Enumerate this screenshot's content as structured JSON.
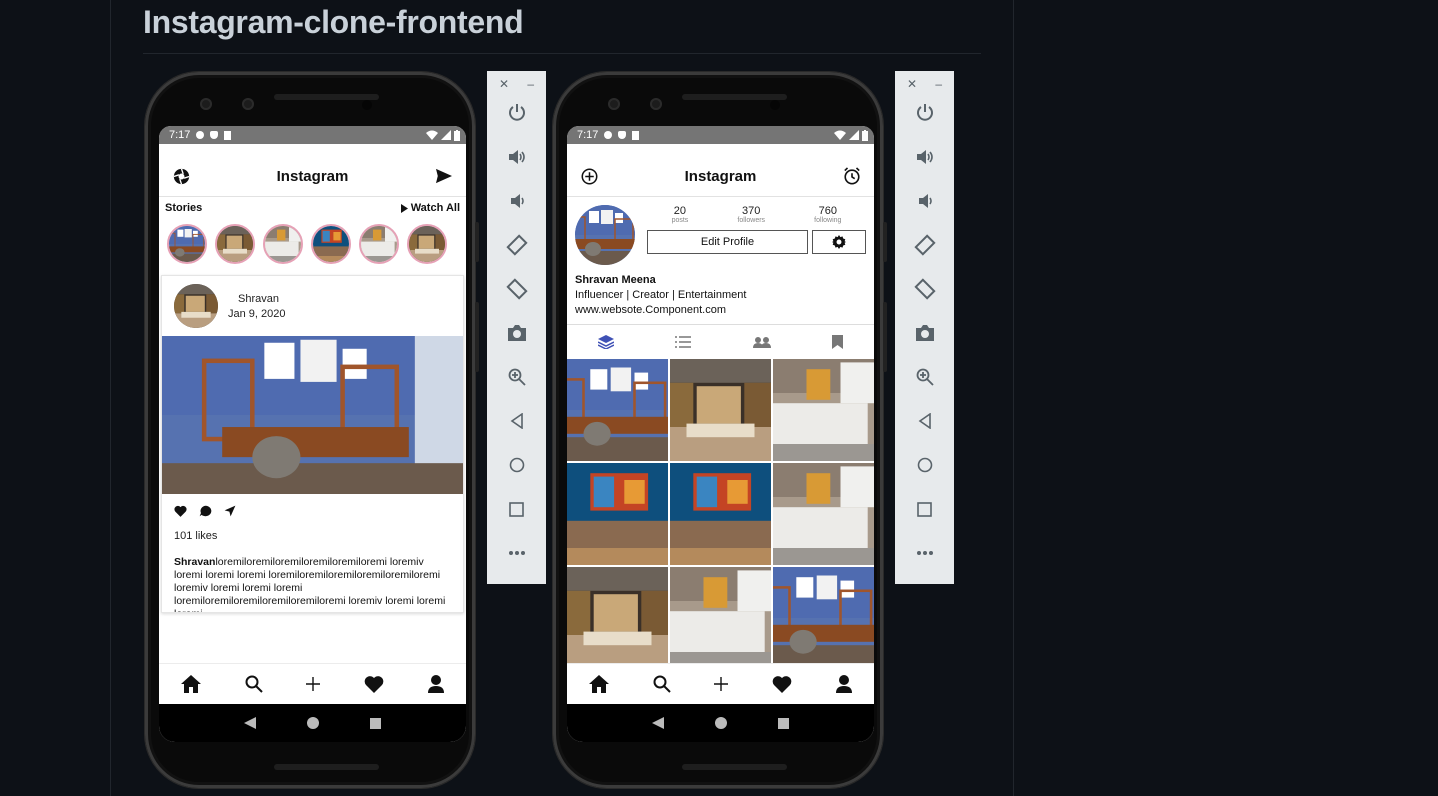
{
  "readme": {
    "title": "Instagram-clone-frontend"
  },
  "status_bar": {
    "time": "7:17"
  },
  "feed": {
    "app_title": "Instagram",
    "header_left_icon": "camera-shutter-icon",
    "header_right_icon": "send-icon",
    "stories_label": "Stories",
    "watch_all_label": "Watch All",
    "stories": [
      "office",
      "living-room",
      "kitchen",
      "blue-wall",
      "kitchen",
      "living-room"
    ],
    "post": {
      "username": "Shravan",
      "date": "Jan 9, 2020",
      "likes": "101 likes",
      "caption_user": "Shravan",
      "caption_text": "loremiloremiloremiloremiloremiloremi loremiv loremi loremi loremi loremiloremiloremiloremiloremiloremi loremiv loremi loremi loremi loremiloremiloremiloremiloremiloremi loremiv loremi loremi loremi"
    }
  },
  "profile": {
    "app_title": "Instagram",
    "header_left_icon": "add-circle-icon",
    "header_right_icon": "alarm-icon",
    "posts_count": "20",
    "posts_label": "posts",
    "followers_count": "370",
    "followers_label": "followers",
    "following_count": "760",
    "following_label": "following",
    "edit_profile_label": "Edit Profile",
    "name": "Shravan Meena",
    "bio": "Influencer | Creator | Entertainment",
    "website": "www.websote.Component.com",
    "grid": [
      "office",
      "living-room",
      "kitchen",
      "blue-wall",
      "blue-wall",
      "kitchen",
      "living-room",
      "kitchen",
      "office"
    ]
  },
  "tabbar_icons": [
    "home-icon",
    "search-icon",
    "add-icon",
    "heart-icon",
    "person-icon"
  ],
  "emulator_toolbar": [
    "power-icon",
    "volume-up-icon",
    "volume-down-icon",
    "rotate-left-icon",
    "rotate-right-icon",
    "camera-icon",
    "zoom-in-icon",
    "back-icon",
    "home-circle-icon",
    "overview-icon",
    "more-icon"
  ],
  "colors": {
    "page_bg": "#0d1117",
    "status_bar": "#757575",
    "story_ring": "#e6a1b6",
    "toolbar_bg": "#e7eaec",
    "toolbar_icon": "#59636a",
    "active_tab": "#3f51b5"
  }
}
